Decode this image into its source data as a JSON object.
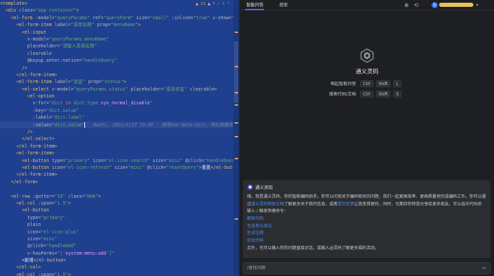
{
  "editor": {
    "inspections": {
      "warnings": "23",
      "weak_warnings": "7",
      "typos": "5"
    },
    "lines": [
      [
        [
          "t",
          "<template>"
        ]
      ],
      [
        [
          "t",
          "  <div "
        ],
        [
          "a",
          "class="
        ],
        [
          "s",
          "\"app-container\""
        ],
        [
          "t",
          ">"
        ]
      ],
      [
        [
          "t",
          "    <el-form "
        ],
        [
          "a",
          ":model="
        ],
        [
          "s",
          "\"queryParams\" "
        ],
        [
          "a",
          "ref="
        ],
        [
          "s",
          "\"queryForm\" "
        ],
        [
          "a",
          "size="
        ],
        [
          "s",
          "\"small\" "
        ],
        [
          "a",
          ":inline="
        ],
        [
          "s",
          "\"true\" "
        ],
        [
          "a",
          "v-show="
        ],
        [
          "s",
          "\"showSearch\""
        ]
      ],
      [
        [
          "t",
          "      <el-form-item "
        ],
        [
          "a",
          "label="
        ],
        [
          "s",
          "\"菜单名称\" "
        ],
        [
          "a",
          "prop="
        ],
        [
          "s",
          "\"menuName\""
        ],
        [
          "t",
          ">"
        ]
      ],
      [
        [
          "t",
          "        <el-input"
        ]
      ],
      [
        [
          "a",
          "          v-model="
        ],
        [
          "s",
          "\"queryParams.menuName\""
        ]
      ],
      [
        [
          "a",
          "          placeholder="
        ],
        [
          "s",
          "\"请输入菜单名称\""
        ]
      ],
      [
        [
          "a",
          "          clearable"
        ]
      ],
      [
        [
          "a",
          "          @keyup.enter.native="
        ],
        [
          "s",
          "\"handleQuery\""
        ]
      ],
      [
        [
          "t",
          "        />"
        ]
      ],
      [
        [
          "t",
          "      </el-form-item>"
        ]
      ],
      [
        [
          "t",
          "      <el-form-item "
        ],
        [
          "a",
          "label="
        ],
        [
          "s",
          "\"状态\" "
        ],
        [
          "a",
          "prop="
        ],
        [
          "s",
          "\"status\""
        ],
        [
          "t",
          ">"
        ]
      ],
      [
        [
          "t",
          "        <el-select "
        ],
        [
          "a",
          "v-model="
        ],
        [
          "s",
          "\"queryParams.status\" "
        ],
        [
          "a",
          "placeholder="
        ],
        [
          "s",
          "\"菜单状态\" "
        ],
        [
          "a",
          "clearable"
        ],
        [
          "t",
          ">"
        ]
      ],
      [
        [
          "t",
          "          <el-option"
        ]
      ],
      [
        [
          "a",
          "            v-for="
        ],
        [
          "s",
          "\"dict "
        ],
        [
          "kw",
          "in "
        ],
        [
          "s",
          "dict.type."
        ],
        [
          "sr",
          "sys_normal_disable"
        ],
        [
          "s",
          "\""
        ]
      ],
      [
        [
          "a",
          "            :key="
        ],
        [
          "s",
          "\"dict.value\""
        ]
      ],
      [
        [
          "a",
          "            :label="
        ],
        [
          "s",
          "\"dict.label\""
        ]
      ],
      [
        [
          "a",
          "            :value="
        ],
        [
          "s",
          "\"dict.value\""
        ],
        [
          "caret",
          ""
        ],
        [
          "cm",
          "   RuoYi, 2021/4/17 15:36 · 使用vue-data-dict，简化数据字典使用"
        ]
      ],
      [
        [
          "t",
          "          />"
        ]
      ],
      [
        [
          "t",
          "        </el-select>"
        ]
      ],
      [
        [
          "t",
          "      </el-form-item>"
        ]
      ],
      [
        [
          "t",
          "      <el-form-item>"
        ]
      ],
      [
        [
          "t",
          "        <el-button "
        ],
        [
          "a",
          "type="
        ],
        [
          "s",
          "\"primary\" "
        ],
        [
          "a",
          "icon="
        ],
        [
          "s",
          "\"el-icon-search\" "
        ],
        [
          "a",
          "size="
        ],
        [
          "s",
          "\"mini\" "
        ],
        [
          "a",
          "@click="
        ],
        [
          "s",
          "\"handleQuery\""
        ],
        [
          "t",
          ">"
        ],
        [
          "fn",
          "搜索"
        ]
      ],
      [
        [
          "t",
          "        <el-button "
        ],
        [
          "a",
          "icon="
        ],
        [
          "s",
          "\"el-icon-refresh\" "
        ],
        [
          "a",
          "size="
        ],
        [
          "s",
          "\"mini\" "
        ],
        [
          "a",
          "@click="
        ],
        [
          "s",
          "\"resetQuery\""
        ],
        [
          "t",
          ">"
        ],
        [
          "fn",
          "重置"
        ],
        [
          "t",
          "</el-button>"
        ]
      ],
      [
        [
          "t",
          "      </el-form-item>"
        ]
      ],
      [
        [
          "t",
          "    </el-form>"
        ]
      ],
      [
        [
          "fn",
          ""
        ]
      ],
      [
        [
          "t",
          "    <el-row "
        ],
        [
          "a",
          ":gutter="
        ],
        [
          "s",
          "\"10\" "
        ],
        [
          "a",
          "class="
        ],
        [
          "s",
          "\"mb8\""
        ],
        [
          "t",
          ">"
        ]
      ],
      [
        [
          "t",
          "      <el-col "
        ],
        [
          "a",
          ":span="
        ],
        [
          "s",
          "\"1.5\""
        ],
        [
          "t",
          ">"
        ]
      ],
      [
        [
          "t",
          "        <el-button"
        ]
      ],
      [
        [
          "a",
          "          type="
        ],
        [
          "s",
          "\"primary\""
        ]
      ],
      [
        [
          "a",
          "          plain"
        ]
      ],
      [
        [
          "a",
          "          icon="
        ],
        [
          "s",
          "\"el-icon-plus\""
        ]
      ],
      [
        [
          "a",
          "          size="
        ],
        [
          "s",
          "\"mini\""
        ]
      ],
      [
        [
          "a",
          "          @click="
        ],
        [
          "s",
          "\"handleAdd\""
        ]
      ],
      [
        [
          "a",
          "          v-hasPermi="
        ],
        [
          "s",
          "\"['"
        ],
        [
          "sr",
          "system:menu:add"
        ],
        [
          "s",
          "']\""
        ]
      ],
      [
        [
          "fn",
          "        >新增"
        ],
        [
          "t",
          "</el-button>"
        ]
      ],
      [
        [
          "t",
          "      </el-col>"
        ]
      ],
      [
        [
          "t",
          "      <el-col "
        ],
        [
          "a",
          ":span="
        ],
        [
          "s",
          "\"1.5\""
        ],
        [
          "t",
          ">"
        ]
      ]
    ]
  },
  "panel": {
    "tabs": {
      "chat": "智能问答",
      "search": "搜索"
    },
    "user_initial": "b",
    "brand_name": "通义灵码",
    "shortcuts": [
      {
        "label": "唤起智能问答",
        "keys": [
          "Ctrl",
          "Shift",
          "L"
        ]
      },
      {
        "label": "搜索代码/文档",
        "keys": [
          "Ctrl",
          "Shift",
          "S"
        ]
      }
    ],
    "card": {
      "title": "通义灵码",
      "intro_1": "嗨，我是通义灵码，你的智能编码助手。你可以问我关于编码相关的问题，我们一起更高效率、更高质量地完成编码工作。你可以通过",
      "intro_link_1": "通义灵码帮助文档",
      "intro_2": "了解更多关于我的信息，或者",
      "intro_link_2": "提交反馈",
      "intro_3": "让我变得更好。同时，也期待你将我分享给更多朋友。可以选中代码后输入 / 触发快捷命令：",
      "quick_commands": [
        "解释代码",
        "生成单元测试",
        "生成注释",
        "优化代码"
      ],
      "outro": "另外，也可以输入你的问题直接对话，或输入@灵码了解更多福利活动。"
    },
    "input": {
      "placeholder": "/查找问题",
      "value": ""
    }
  },
  "colors": {
    "editor_bg": "#1f3f8f",
    "panel_bg": "#1e1f22",
    "accent": "#3574f0",
    "link": "#4b8cf5"
  }
}
